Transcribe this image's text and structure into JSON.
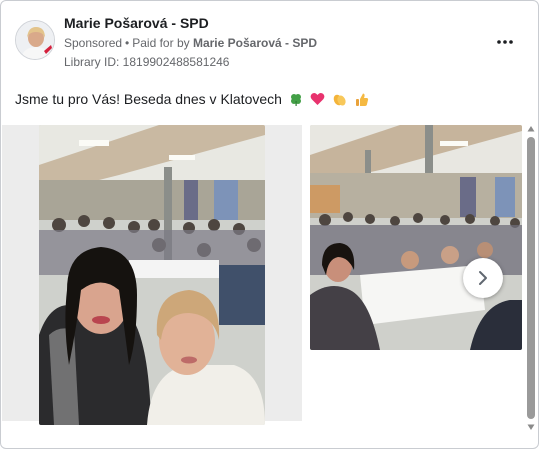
{
  "header": {
    "page_name": "Marie Pošarová - SPD",
    "sponsored_label": "Sponsored",
    "dot": "•",
    "paid_for_by_label": "Paid for by",
    "paid_for_by_name": "Marie Pošarová - SPD",
    "library_id": "Library ID: 1819902488581246",
    "more_icon": "more-horizontal-icon"
  },
  "post": {
    "text": "Jsme tu pro Vás! Beseda dnes v Klatovech",
    "emojis": [
      "clover-emoji",
      "heart-emoji",
      "clapping-hands-emoji",
      "thumbs-up-emoji"
    ]
  },
  "carousel": {
    "images": [
      "selfie-in-event-hall",
      "audience-at-tables"
    ],
    "next_icon": "chevron-right-icon"
  },
  "colors": {
    "text_primary": "#1c1e21",
    "text_secondary": "#65676b",
    "border": "#c9ccd1",
    "heart": "#e8336e",
    "clover": "#43a047"
  }
}
